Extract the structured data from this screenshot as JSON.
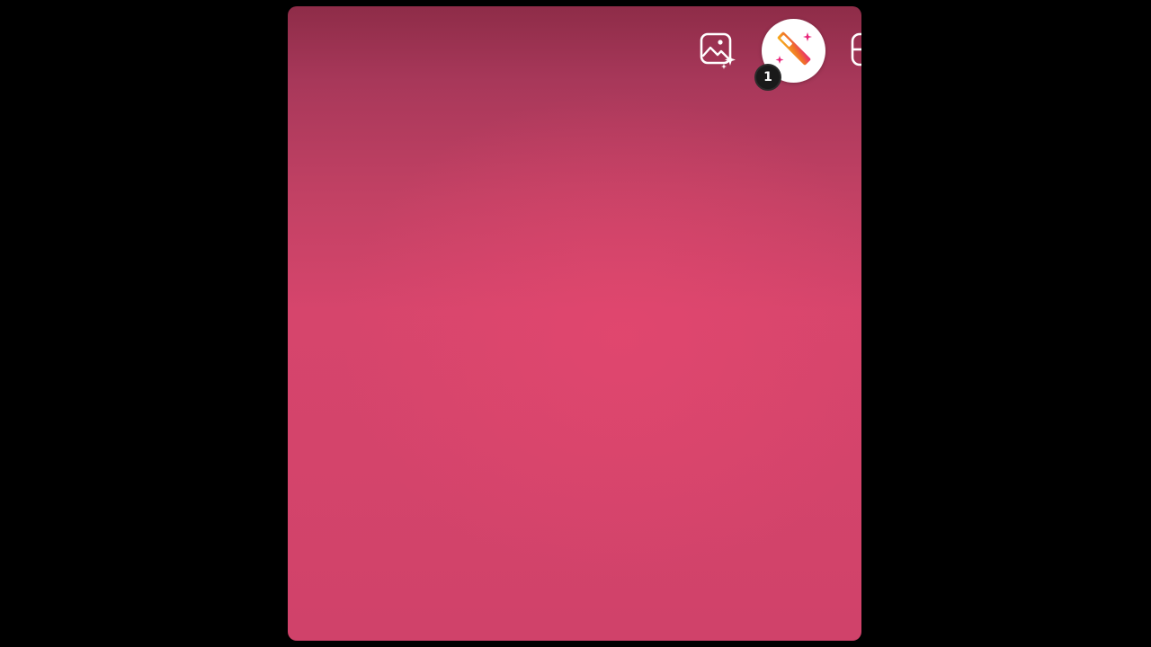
{
  "toolbar": {
    "magic_wand": {
      "badge_text": "1"
    }
  },
  "colors": {
    "backdrop": "#000000",
    "canvas_top": "#8e2c48",
    "canvas_mid": "#d6456c",
    "canvas_bottom": "#d0426a",
    "wand_orange": "#f59a1a",
    "wand_pink": "#e8257a",
    "badge_bg": "#1a1a1a"
  },
  "icons": [
    "photo-sparkle-icon",
    "magic-wand-icon",
    "partial-toolbar-icon"
  ]
}
